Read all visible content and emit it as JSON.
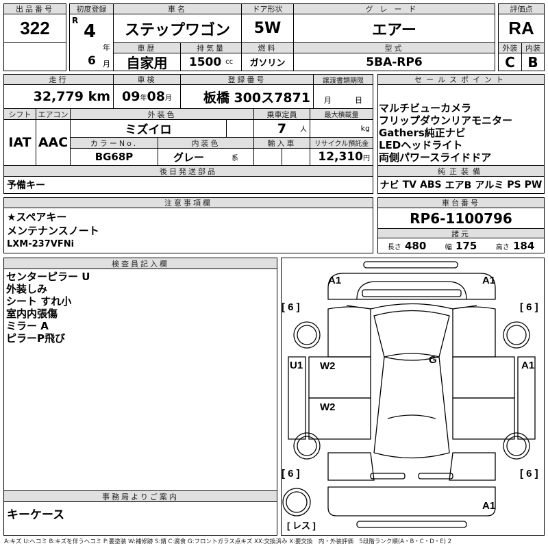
{
  "lot": {
    "label": "出品番号",
    "value": "322"
  },
  "first_reg": {
    "label": "初度登録",
    "era": "R",
    "year": "4",
    "year_unit": "年",
    "month": "6",
    "month_unit": "月"
  },
  "car_name": {
    "label": "車名",
    "value": "ステップワゴン"
  },
  "door": {
    "label": "ドア形状",
    "value": "5W"
  },
  "grade": {
    "label": "グレード",
    "value": "エアー"
  },
  "history": {
    "label": "車歴",
    "value": "自家用"
  },
  "displacement": {
    "label": "排気量",
    "value": "1500",
    "unit": "cc"
  },
  "fuel": {
    "label": "燃料",
    "value": "ガソリン"
  },
  "model": {
    "label": "型式",
    "value": "5BA-RP6"
  },
  "score": {
    "label": "評価点",
    "value": "RA",
    "ext_label": "外装",
    "int_label": "内装",
    "ext": "C",
    "int": "B"
  },
  "mileage": {
    "label": "走行",
    "value": "32,779",
    "unit": "km"
  },
  "inspection": {
    "label": "車検",
    "year": "09",
    "year_unit": "年",
    "month": "08",
    "month_unit": "月"
  },
  "plate": {
    "label": "登録番号",
    "value": "板橋 300ス7871"
  },
  "transfer": {
    "label": "譲渡書類期限",
    "month_unit": "月",
    "day_unit": "日"
  },
  "shift": {
    "label": "シフト",
    "value": "IAT"
  },
  "ac": {
    "label": "エアコン",
    "value": "AAC"
  },
  "ext_color": {
    "label": "外装色",
    "value": "ミズイロ"
  },
  "capacity": {
    "label": "乗車定員",
    "value": "7",
    "unit": "人"
  },
  "max_load": {
    "label": "最大積載量",
    "unit": "kg"
  },
  "color_no": {
    "label": "カラーNo.",
    "value": "BG68P"
  },
  "int_color": {
    "label": "内装色",
    "value": "グレー",
    "unit": "系"
  },
  "import": {
    "label": "輸入車"
  },
  "recycle": {
    "label": "リサイクル預託金",
    "value": "12,310",
    "unit": "円"
  },
  "later_parts": {
    "label": "後日発送部品",
    "value": "予備キー"
  },
  "sales_points": {
    "label": "セールスポイント",
    "items": [
      "マルチビューカメラ",
      "フリップダウンリアモニター",
      "Gathers純正ナビ",
      "LEDヘッドライト",
      "両側パワースライドドア"
    ]
  },
  "equipment": {
    "label": "純正装備",
    "items": [
      "ナビ",
      "TV",
      "ABS",
      "エアB",
      "アルミ",
      "PS",
      "PW"
    ]
  },
  "notes": {
    "label": "注意事項欄",
    "items": [
      "★スペアキー",
      "メンテナンスノート",
      "LXM-237VFNi"
    ]
  },
  "chassis": {
    "label": "車台番号",
    "value": "RP6-1100796"
  },
  "specs": {
    "label": "諸元",
    "length_label": "長さ",
    "length": "480",
    "width_label": "幅",
    "width": "175",
    "height_label": "高さ",
    "height": "184"
  },
  "inspector": {
    "label": "検査員記入欄",
    "items": [
      "センターピラー U",
      "外装しみ",
      "シート すれ小",
      "室内内張傷",
      "ミラー A",
      "ピラーP飛び"
    ]
  },
  "office": {
    "label": "事務局よりご案内",
    "value": "キーケース"
  },
  "diagram": {
    "marks": [
      "A1",
      "A1",
      "[ 6 ]",
      "[ 6 ]",
      "U1",
      "W2",
      "G",
      "A1",
      "W2",
      "[ 6 ]",
      "[ 6 ]",
      "A1",
      "[ レス ]"
    ]
  },
  "legend": "A:キズ U:ヘコミ B:キズを伴うヘコミ P:要塗装 W:補修跡 S:錆 C:腐食 G:フロントガラス点キズ XX:交換済み X:要交換　内・外装評価　5段階ランク順(A・B・C・D・E) 2"
}
